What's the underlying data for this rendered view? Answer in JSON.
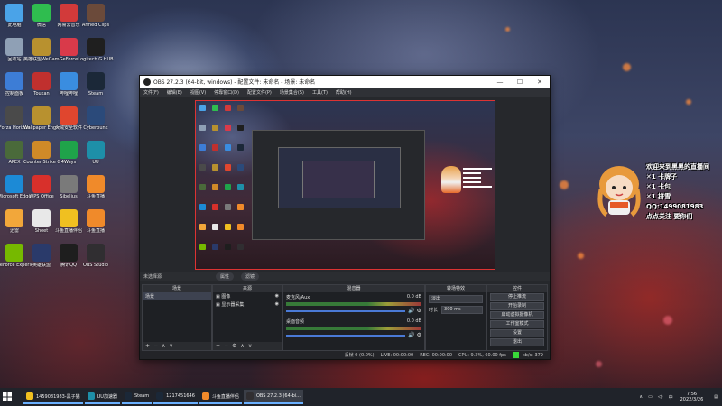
{
  "desktop": {
    "icons": [
      {
        "label": "此电脑",
        "color": "#4aa3e8"
      },
      {
        "label": "微信",
        "color": "#2fbd4f"
      },
      {
        "label": "网易云音乐",
        "color": "#d23a3a"
      },
      {
        "label": "Armed Clips",
        "color": "#6b4a3a"
      },
      {
        "label": "回收站",
        "color": "#8fa0b5"
      },
      {
        "label": "英雄联盟WeGame平台",
        "color": "#b8912f"
      },
      {
        "label": "GeForce",
        "color": "#d93a4a"
      },
      {
        "label": "Logitech G HUB",
        "color": "#1f1f1f"
      },
      {
        "label": "控制面板",
        "color": "#3d7dd6"
      },
      {
        "label": "Toukan",
        "color": "#c0302e"
      },
      {
        "label": "哔哩哔哩",
        "color": "#3a8de0"
      },
      {
        "label": "Steam",
        "color": "#1b2838"
      },
      {
        "label": "Forza Horizon",
        "color": "#4a4a4a"
      },
      {
        "label": "Wallpaper Engine",
        "color": "#b8912f"
      },
      {
        "label": "火绒安全软件",
        "color": "#e0462e"
      },
      {
        "label": "Cyberpunk",
        "color": "#2b4a7a"
      },
      {
        "label": "APEX",
        "color": "#4a6a3a"
      },
      {
        "label": "Counter-Strike Global Offensive",
        "color": "#d08a28"
      },
      {
        "label": "4Ways",
        "color": "#1fa34a"
      },
      {
        "label": "UU",
        "color": "#1e8fa8"
      },
      {
        "label": "Microsoft Edge",
        "color": "#1c8ad6"
      },
      {
        "label": "WPS Office",
        "color": "#d8302b"
      },
      {
        "label": "Sibelius",
        "color": "#7a7a7a"
      },
      {
        "label": "斗鱼直播",
        "color": "#f08a2a"
      },
      {
        "label": "迅雷",
        "color": "#f2a73a"
      },
      {
        "label": "Sheet",
        "color": "#e8e8e8"
      },
      {
        "label": "斗鱼直播伴侣",
        "color": "#f0c020"
      },
      {
        "label": "斗鱼直播",
        "color": "#f08a2a"
      },
      {
        "label": "GeForce Experience",
        "color": "#76b900"
      },
      {
        "label": "英雄联盟",
        "color": "#2a3a6a"
      },
      {
        "label": "腾讯QQ",
        "color": "#1e1e1e"
      },
      {
        "label": "OBS Studio",
        "color": "#302e31"
      }
    ]
  },
  "obs": {
    "title": "OBS 27.2.3 (64-bit, windows) - 配置文件: 未命名 - 场景: 未命名",
    "menu": [
      "文件(F)",
      "编辑(E)",
      "视图(V)",
      "停靠窗口(D)",
      "配置文件(P)",
      "场景集合(S)",
      "工具(T)",
      "帮助(H)"
    ],
    "toolbar": {
      "label": "未选择源",
      "props": "属性",
      "filters": "滤镜"
    },
    "docks": {
      "scenes": {
        "title": "场景",
        "items": [
          "场景"
        ]
      },
      "sources": {
        "title": "来源",
        "items": [
          "图像",
          "显示器采集"
        ]
      },
      "mixer": {
        "title": "混音器",
        "tracks": [
          {
            "name": "麦克风/Aux",
            "level": "0.0 dB"
          },
          {
            "name": "桌面音频",
            "level": "0.0 dB"
          }
        ]
      },
      "transitions": {
        "title": "转场特效",
        "type": "淡出",
        "duration_label": "时长",
        "duration": "300 ms"
      },
      "controls": {
        "title": "控件",
        "buttons": [
          "停止推流",
          "开始录制",
          "启动虚拟摄像机",
          "工作室模式",
          "设置",
          "退出"
        ]
      }
    },
    "status": {
      "dropped": "丢帧 0 (0.0%)",
      "live": "LIVE: 00:00:00",
      "rec": "REC: 00:00:00",
      "cpu": "CPU: 9.3%, 60.00 fps",
      "kbps": "kb/s: 379"
    }
  },
  "overlay": {
    "lines": [
      "欢迎来到黑黑的直播间",
      "✕1 卡牌子",
      "✕1 卡包",
      "✕1 拼雪",
      "QQ:1499081983",
      "点点关注 要你们"
    ]
  },
  "taskbar": {
    "apps": [
      {
        "label": "1459081983-黑子猫",
        "color": "#f0c020",
        "active": false
      },
      {
        "label": "UU加速器",
        "color": "#1e8fa8",
        "active": false
      },
      {
        "label": "Steam",
        "color": "#1b2838",
        "active": false
      },
      {
        "label": "1217451646",
        "color": "#1b2838",
        "active": false
      },
      {
        "label": "斗鱼直播伴侣",
        "color": "#f08a2a",
        "active": false
      },
      {
        "label": "OBS 27.2.3 (64-bi...",
        "color": "#302e31",
        "active": true
      }
    ],
    "tray_lang": "中",
    "time": "7:56",
    "date": "2022/3/26"
  }
}
